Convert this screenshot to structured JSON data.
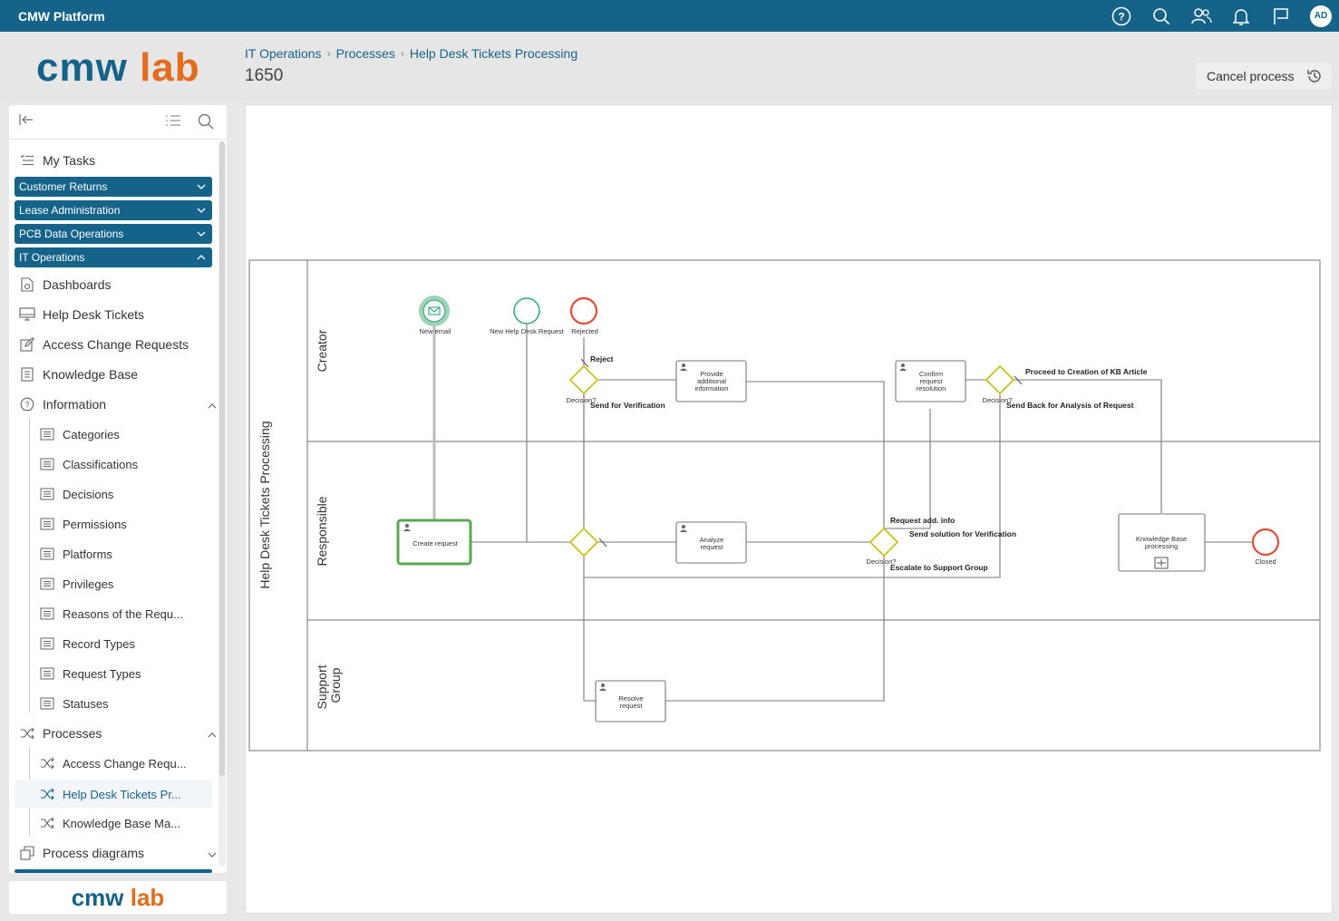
{
  "topbar": {
    "brand": "CMW Platform",
    "avatar_initials": "AD"
  },
  "logo": {
    "part1": "cmw",
    "part2": "lab"
  },
  "breadcrumb": {
    "c1": "IT Operations",
    "c2": "Processes",
    "c3": "Help Desk Tickets Processing"
  },
  "page": {
    "title": "1650"
  },
  "cancel": {
    "label": "Cancel process"
  },
  "sidebar": {
    "my_tasks": "My Tasks",
    "apps": [
      "Customer Returns",
      "Lease Administration",
      "PCB Data Operations",
      "IT Operations"
    ],
    "items": [
      "Dashboards",
      "Help Desk Tickets",
      "Access Change Requests",
      "Knowledge Base",
      "Information"
    ],
    "information_items": [
      "Categories",
      "Classifications",
      "Decisions",
      "Permissions",
      "Platforms",
      "Privileges",
      "Reasons of the Requ...",
      "Record Types",
      "Request Types",
      "Statuses"
    ],
    "processes": "Processes",
    "process_items": [
      "Access Change Requ...",
      "Help Desk Tickets Pr...",
      "Knowledge Base Ma..."
    ],
    "process_diagrams": "Process diagrams"
  },
  "diagram": {
    "pool": "Help Desk Tickets Processing",
    "lanes": {
      "creator": "Creator",
      "responsible": "Responsible",
      "support1": "Support",
      "support2": "Group"
    },
    "events": {
      "new_email": "New email",
      "new_request": "New Help Desk Request",
      "rejected": "Rejected",
      "closed": "Closed"
    },
    "tasks": {
      "provide1": "Provide",
      "provide2": "additional",
      "provide3": "information",
      "confirm1": "Confirm",
      "confirm2": "request",
      "confirm3": "resolution",
      "create": "Create request",
      "analyze1": "Analyze",
      "analyze2": "request",
      "kb1": "Knowledge Base",
      "kb2": "processing",
      "resolve1": "Resolve",
      "resolve2": "request"
    },
    "gateways": {
      "decision": "Decision?"
    },
    "flows": {
      "reject": "Reject",
      "send_verif": "Send for Verification",
      "proceed_kb": "Proceed to Creation of KB Article",
      "send_back": "Send Back for Analysis of Request",
      "req_info": "Request add. info",
      "send_solution": "Send solution for Verification",
      "escalate": "Escalate to Support Group"
    }
  },
  "colors": {
    "brand": "#16638a",
    "accent": "#e36c1d",
    "start_event": "#2aa876",
    "end_event": "#e04b3a",
    "gateway": "#c8c21e",
    "selected_task": "#5aa84f"
  }
}
